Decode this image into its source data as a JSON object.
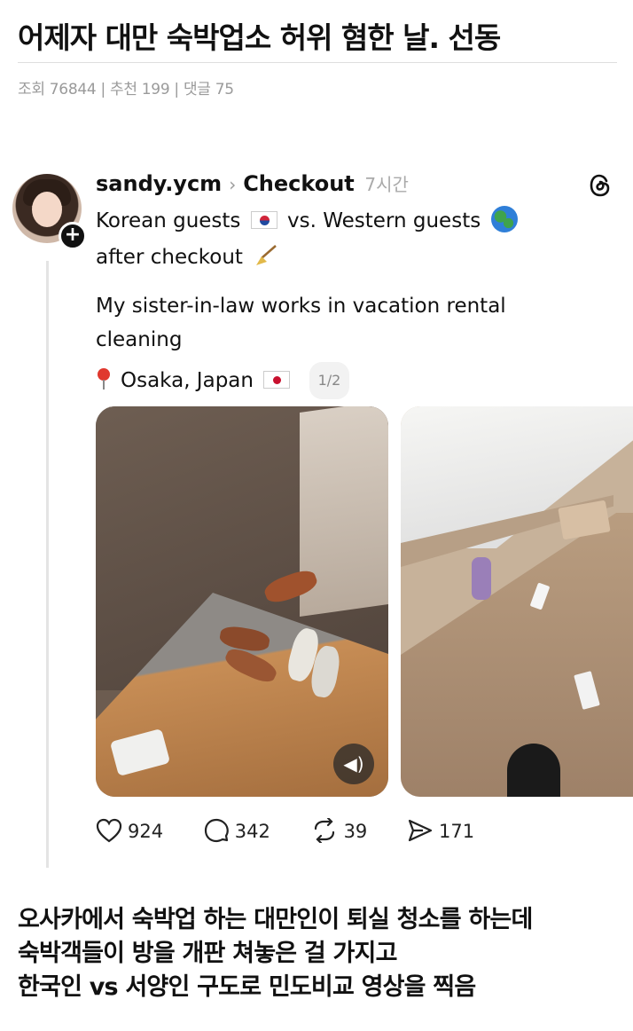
{
  "post": {
    "title": "어제자 대만 숙박업소 허위 혐한 날.   선동",
    "meta": "조회 76844 | 추천 199 | 댓글 75"
  },
  "threads": {
    "username": "sandy.ycm",
    "topic": "Checkout",
    "time": "7시간",
    "line1_a": "Korean guests",
    "line1_b": "vs. Western guests",
    "line2": "after checkout",
    "body_line1": "My sister-in-law works in vacation rental",
    "body_line2": "cleaning",
    "location": "Osaka, Japan",
    "pager": "1/2",
    "likes": "924",
    "replies": "342",
    "reposts": "39",
    "shares": "171",
    "icons": [
      "threads-logo-icon",
      "plus-icon",
      "korea-flag-icon",
      "globe-icon",
      "broom-icon",
      "location-pin-icon",
      "japan-flag-icon",
      "speaker-icon",
      "heart-icon",
      "comment-icon",
      "repost-icon",
      "share-icon"
    ]
  },
  "caption": {
    "line1": "오사카에서 숙박업 하는 대만인이 퇴실 청소를 하는데",
    "line2": "숙박객들이 방을 개판 쳐놓은 걸 가지고",
    "line3": "한국인 vs 서양인 구도로 민도비교 영상을 찍음"
  }
}
